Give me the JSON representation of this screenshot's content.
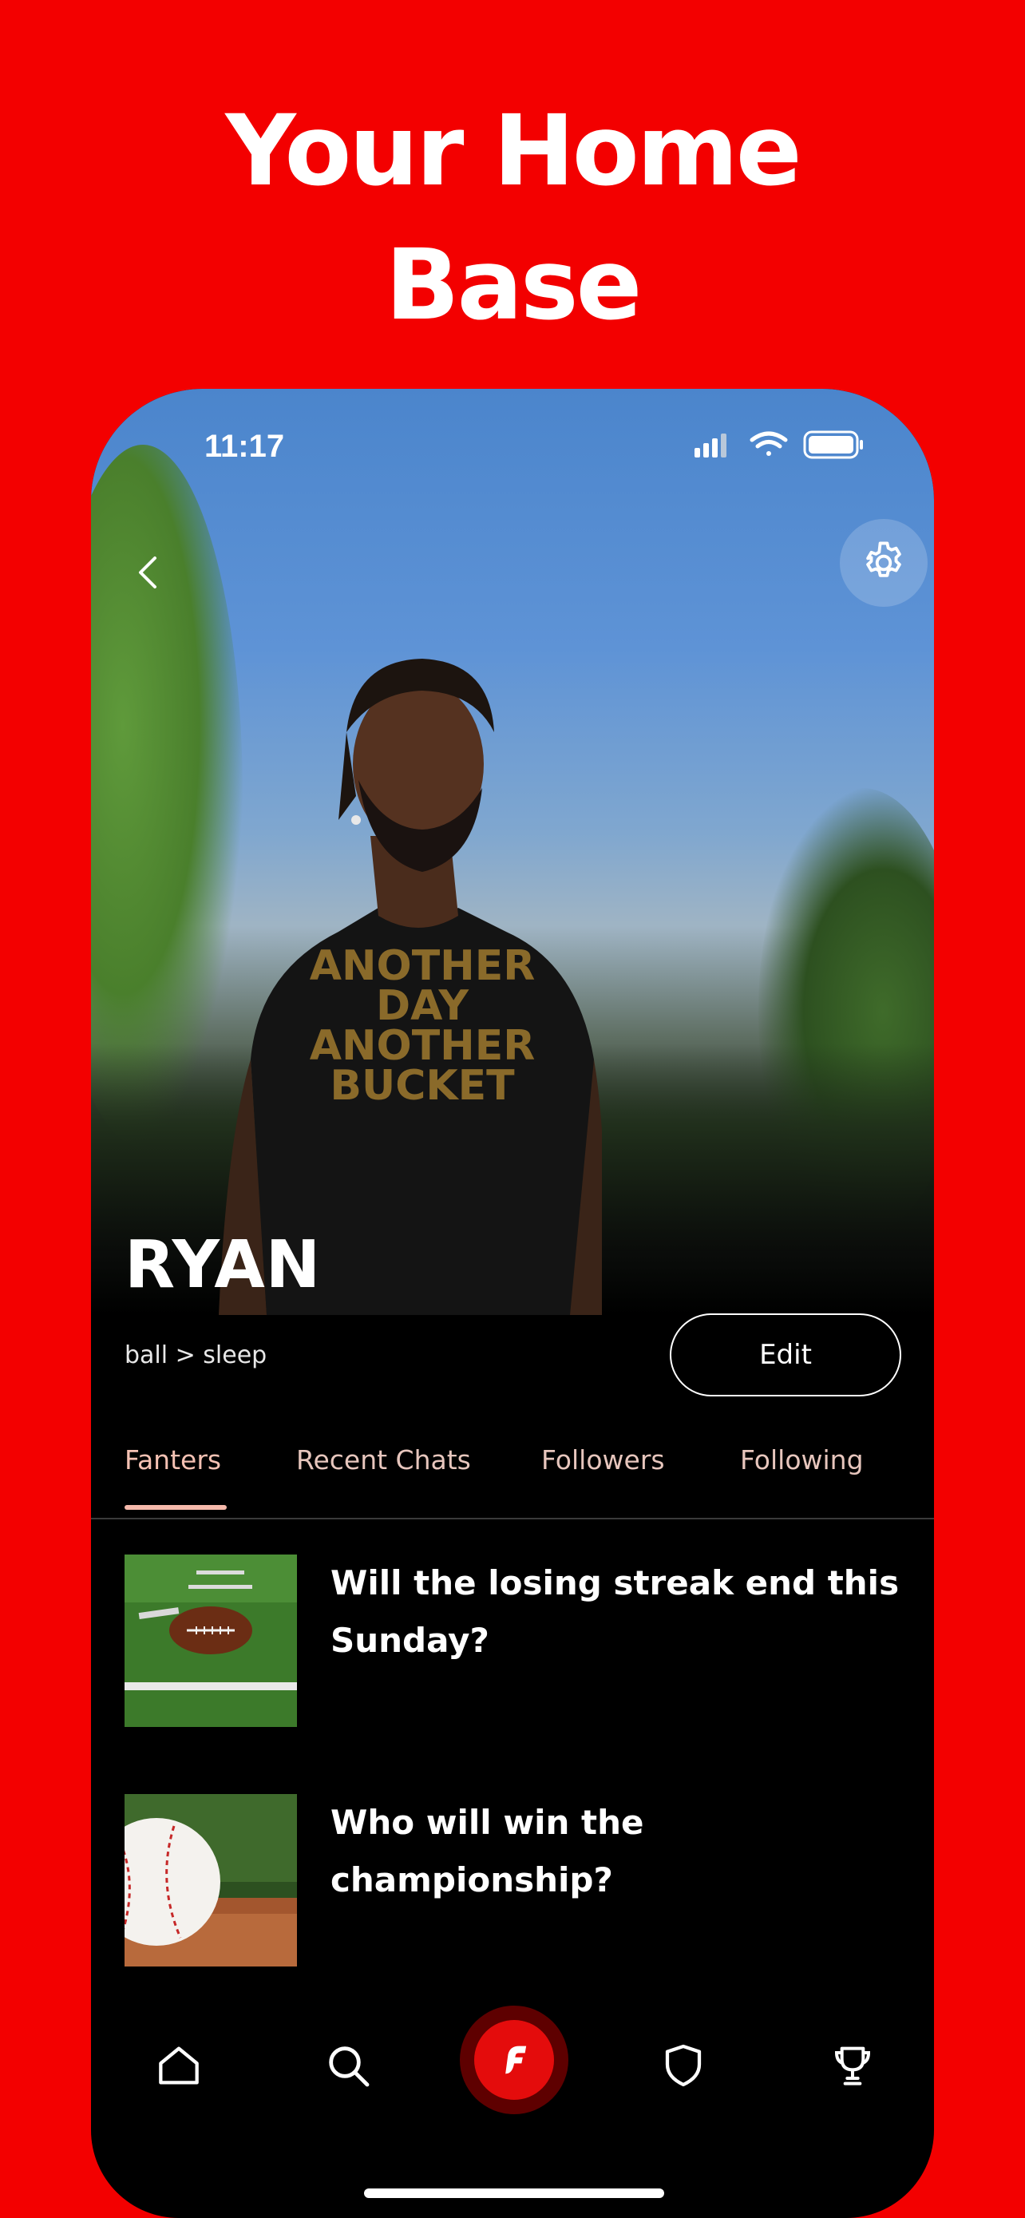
{
  "promo": {
    "headline_line1": "Your Home",
    "headline_line2": "Base"
  },
  "status_bar": {
    "time": "11:17"
  },
  "profile": {
    "name": "RYAN",
    "bio": "ball > sleep",
    "edit_label": "Edit",
    "shirt_text": "ANOTHER DAY ANOTHER BUCKET"
  },
  "tabs": [
    {
      "label": "Fanters",
      "active": true
    },
    {
      "label": "Recent Chats",
      "active": false
    },
    {
      "label": "Followers",
      "active": false
    },
    {
      "label": "Following",
      "active": false
    }
  ],
  "fanters": [
    {
      "title": "Will the losing streak end this Sunday?",
      "thumbnail": "football-on-field"
    },
    {
      "title": "Who will win the championship?",
      "thumbnail": "baseball-on-dirt"
    }
  ],
  "bottom_nav": [
    {
      "name": "home-icon"
    },
    {
      "name": "search-icon"
    },
    {
      "name": "app-logo-icon"
    },
    {
      "name": "shield-icon"
    },
    {
      "name": "trophy-icon"
    }
  ],
  "colors": {
    "brand_red": "#f30000",
    "tab_accent": "#f5b9ab",
    "center_button_red": "#e40c0c"
  }
}
